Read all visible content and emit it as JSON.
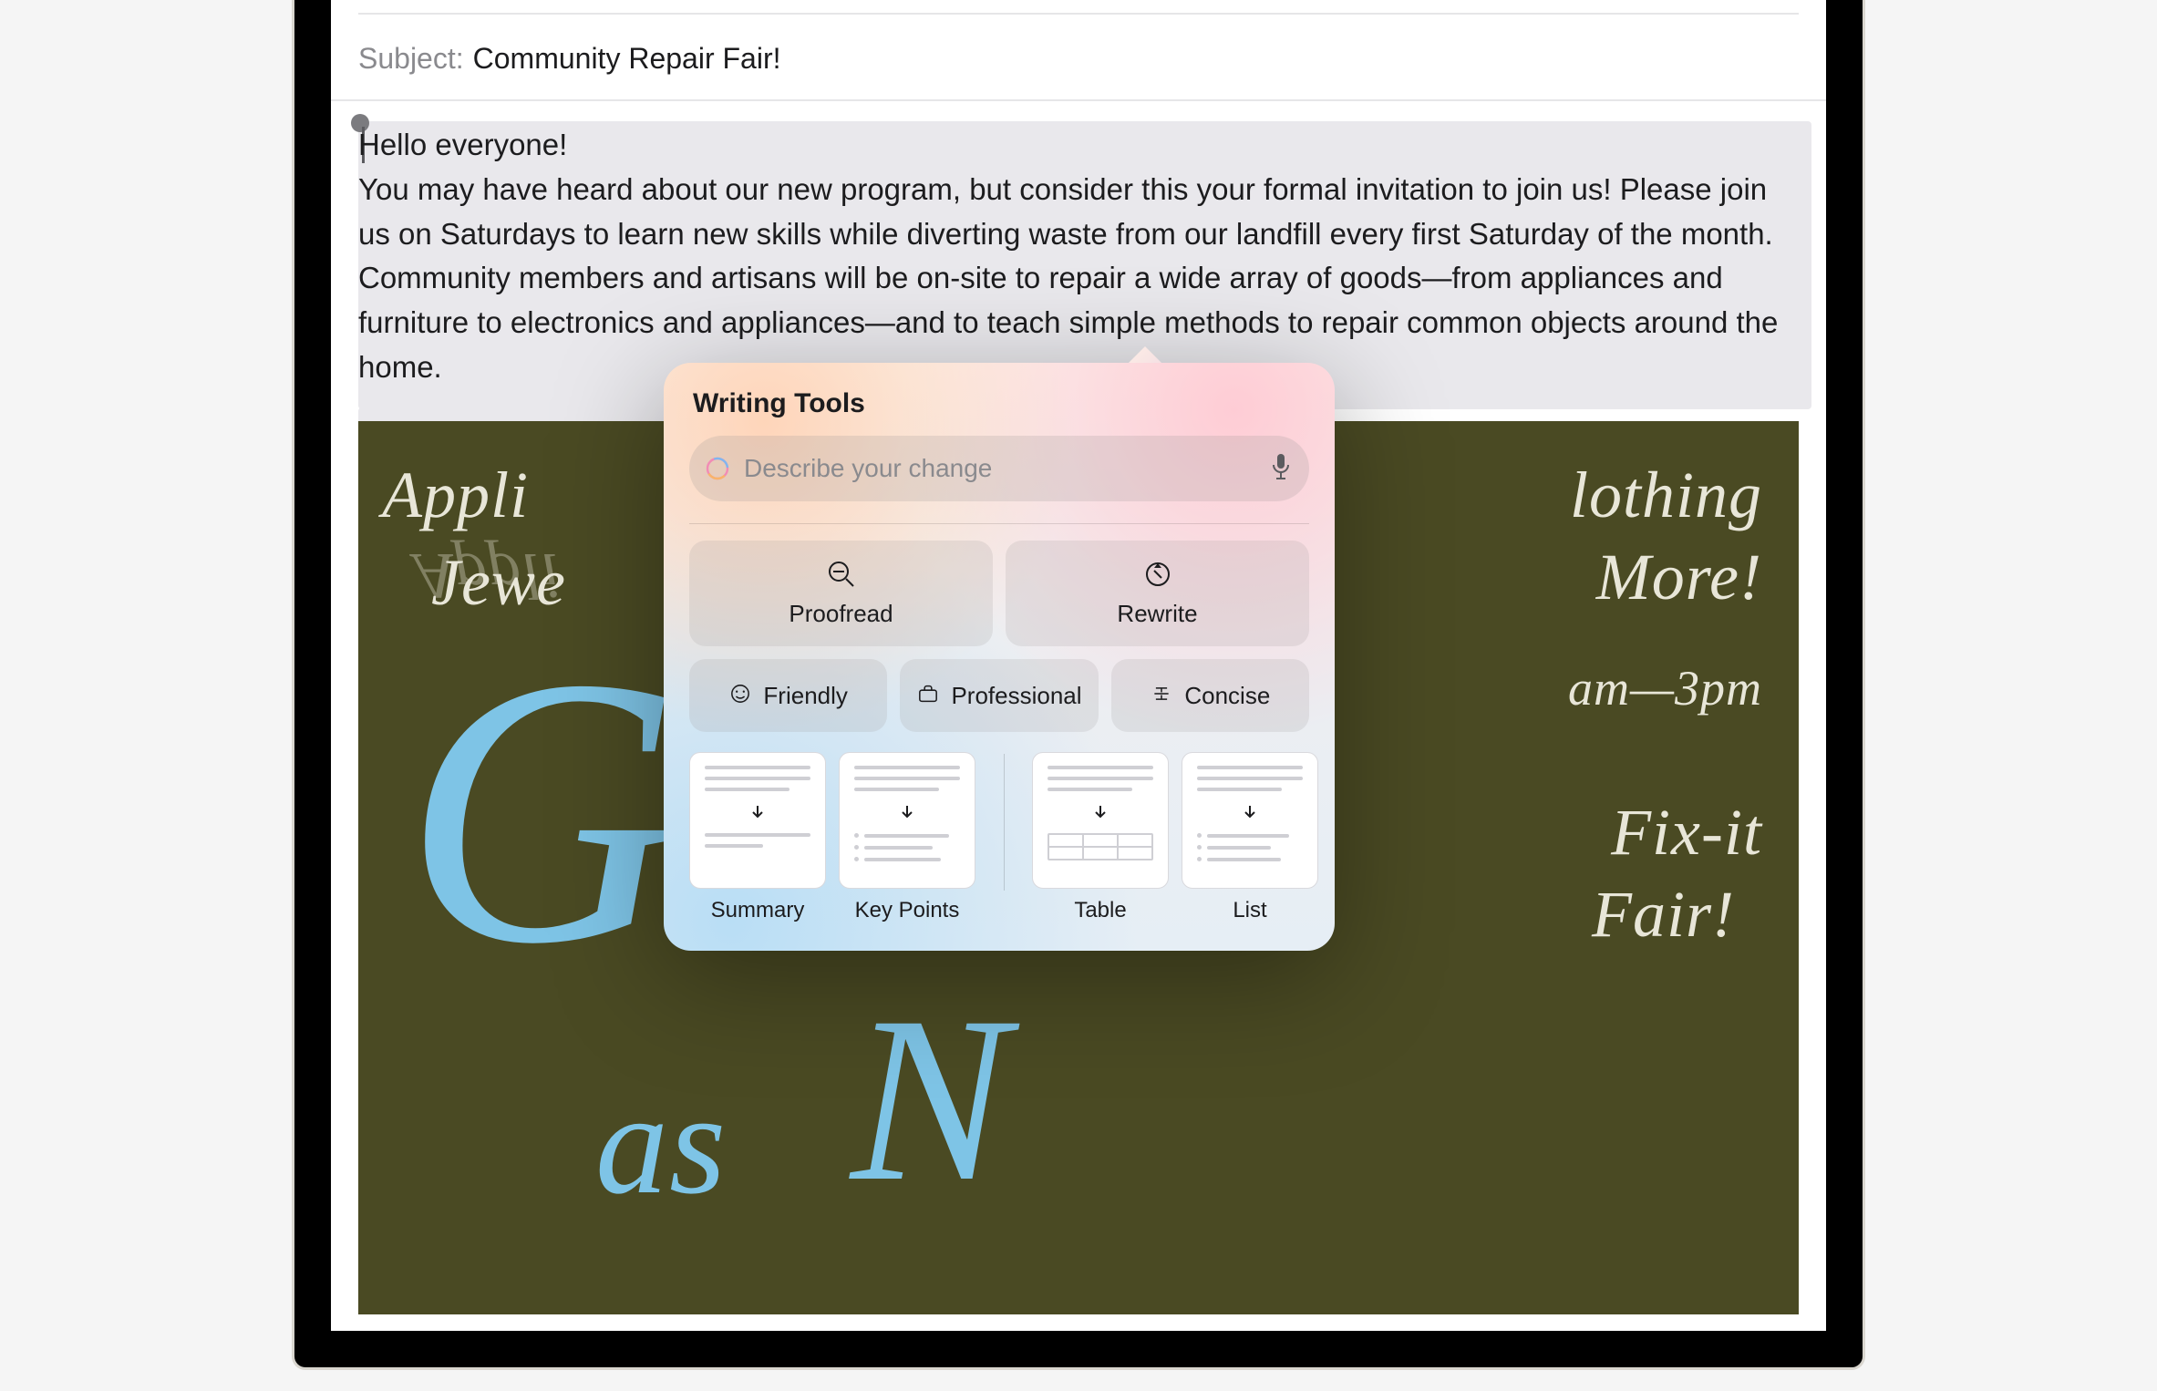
{
  "subject": {
    "label": "Subject:",
    "value": "Community Repair Fair!"
  },
  "body": {
    "greeting": "Hello everyone!",
    "paragraph": "You may have heard about our new program, but consider this your formal invitation to join us! Please join us on Saturdays to learn new skills while diverting waste from our landfill every first Saturday of the month. Community members and artisans will be on-site to repair a wide array of goods—from appliances and furniture to electronics and appliances—and to teach simple methods to repair common objects around the home."
  },
  "poster": {
    "words": {
      "appliances": "Appli",
      "jewelry": "Jewe",
      "clothing": "lothing",
      "more": "More!",
      "time": "am—3pm",
      "fixit": "Fix-it",
      "fair": "Fair!",
      "as": "as"
    }
  },
  "writingTools": {
    "title": "Writing Tools",
    "placeholder": "Describe your change",
    "actions": {
      "proofread": "Proofread",
      "rewrite": "Rewrite",
      "friendly": "Friendly",
      "professional": "Professional",
      "concise": "Concise"
    },
    "formats": {
      "summary": "Summary",
      "keypoints": "Key Points",
      "table": "Table",
      "list": "List"
    }
  }
}
